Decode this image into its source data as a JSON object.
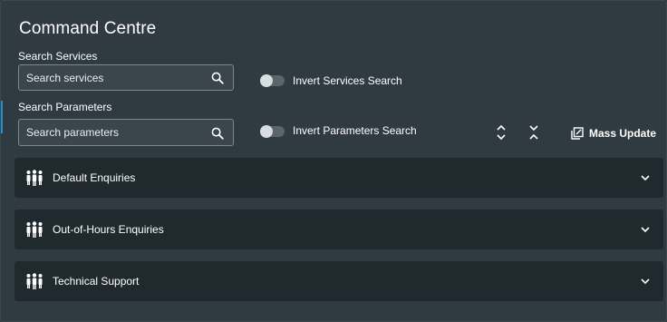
{
  "header": {
    "title": "Command Centre"
  },
  "services": {
    "label": "Search Services",
    "placeholder": "Search services",
    "value": "",
    "invert_label": "Invert Services Search",
    "invert_on": false
  },
  "parameters": {
    "label": "Search Parameters",
    "placeholder": "Search parameters",
    "value": "",
    "invert_label": "Invert Parameters Search",
    "invert_on": false
  },
  "toolbar": {
    "mass_update_label": "Mass Update"
  },
  "accordions": [
    {
      "label": "Default Enquiries",
      "icon": "people-icon",
      "expanded": false
    },
    {
      "label": "Out-of-Hours Enquiries",
      "icon": "people-icon",
      "expanded": false
    },
    {
      "label": "Technical Support",
      "icon": "people-icon",
      "expanded": false
    }
  ],
  "colors": {
    "background": "#2f3a41",
    "accordion_background": "#20292e",
    "accent": "#1f8fd6"
  }
}
